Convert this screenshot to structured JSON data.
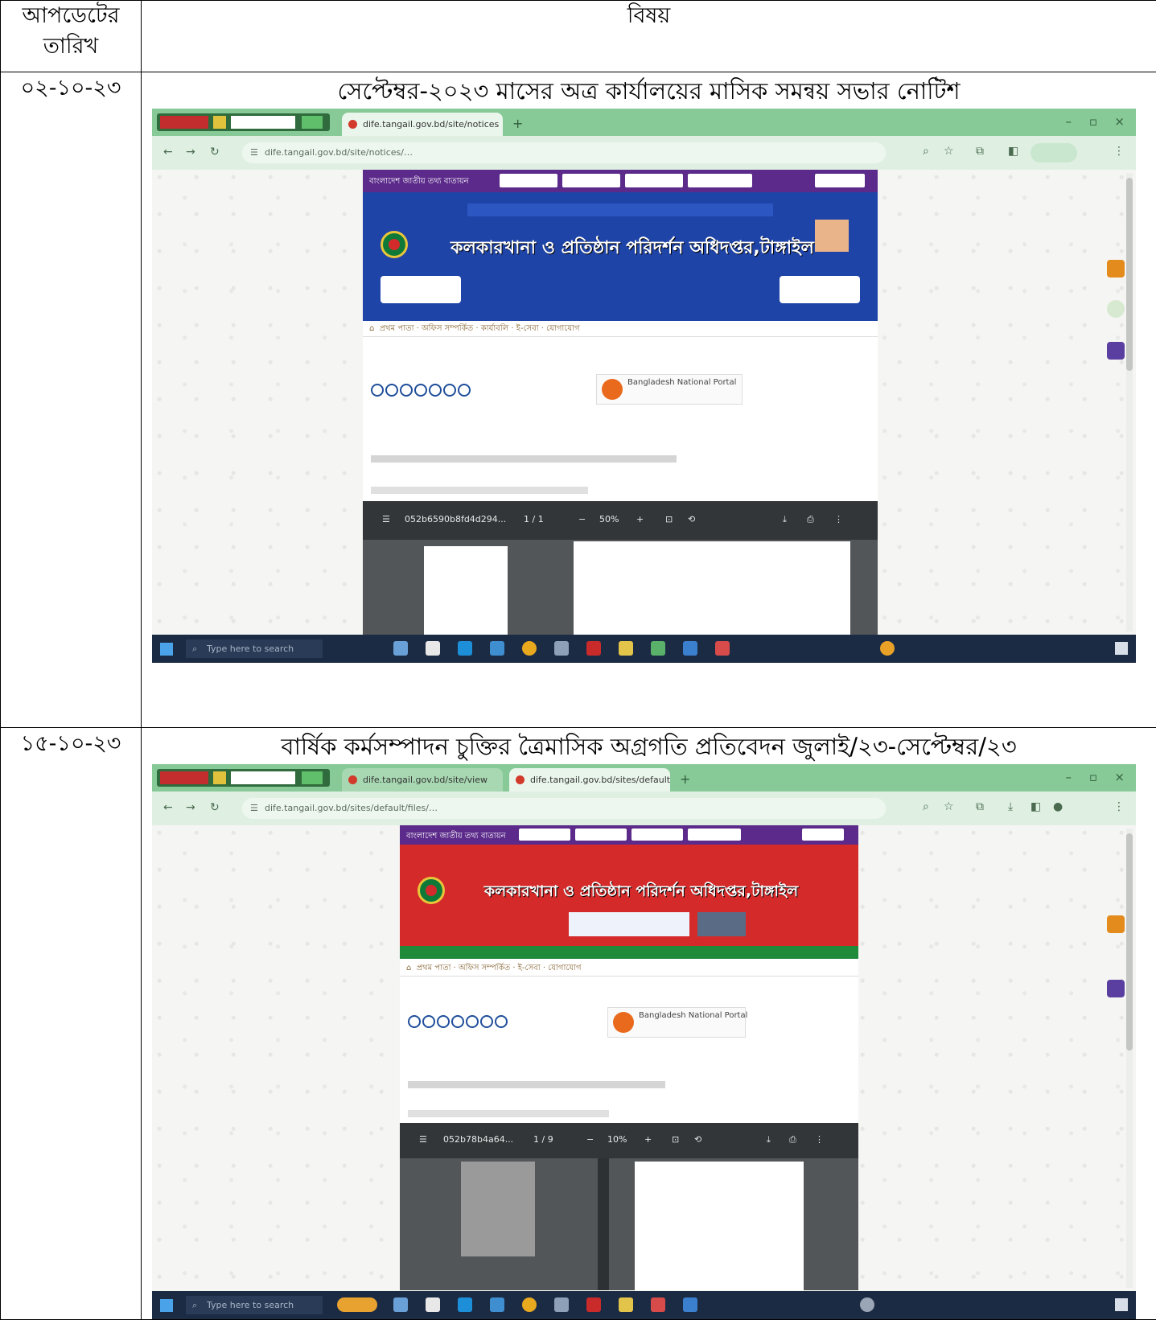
{
  "header": {
    "date_col": "আপডেটের তারিখ",
    "subject_col": "বিষয়"
  },
  "entries": [
    {
      "date": "০২-১০-২৩",
      "title": "সেপ্টেম্বর-২০২৩ মাসের অত্র কার্যালয়ের মাসিক সমন্বয় সভার নোটিশ",
      "screenshot": {
        "banner_title": "কলকারখানা ও প্রতিষ্ঠান পরিদর্শন অধিদপ্তর,টাঙ্গাইল",
        "portal_label": "Bangladesh National Portal",
        "taskbar_search": "Type here to search",
        "pdf_file": "052b6590b8fd4d294...",
        "pdf_page": "1 / 1",
        "pdf_zoom": "50%",
        "banner_color": "#1f44a8"
      }
    },
    {
      "date": "১৫-১০-২৩",
      "title": "বার্ষিক কর্মসম্পাদন চুক্তির ত্রৈমাসিক অগ্রগতি প্রতিবেদন জুলাই/২৩-সেপ্টেম্বর/২৩",
      "screenshot": {
        "banner_title": "কলকারখানা ও প্রতিষ্ঠান পরিদর্শন অধিদপ্তর,টাঙ্গাইল",
        "portal_label": "Bangladesh National Portal",
        "taskbar_search": "Type here to search",
        "pdf_file": "052b78b4a64...",
        "pdf_page": "1 / 9",
        "pdf_zoom": "10%",
        "banner_color": "#d42a2a"
      }
    }
  ]
}
